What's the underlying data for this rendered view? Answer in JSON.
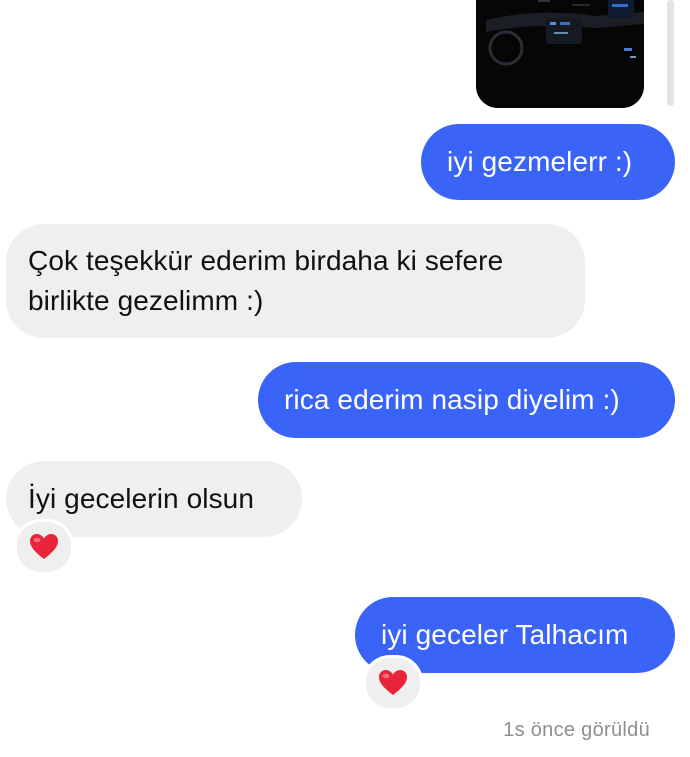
{
  "thread": {
    "messages": [
      {
        "sender": "me",
        "kind": "image"
      },
      {
        "sender": "me",
        "text": "iyi gezmelerr :)"
      },
      {
        "sender": "them",
        "text": "Çok teşekkür ederim birdaha ki sefere birlikte gezelimm :)"
      },
      {
        "sender": "me",
        "text": "rica ederim nasip diyelim :)"
      },
      {
        "sender": "them",
        "text": "İyi gecelerin olsun",
        "reaction": "heart-emoji"
      },
      {
        "sender": "me",
        "text": "iyi geceler Talhacım",
        "reaction": "heart-emoji"
      }
    ],
    "seen_status": "1s önce görüldü"
  },
  "colors": {
    "outgoing_bubble": "#3a63f7",
    "incoming_bubble": "#efefef",
    "reaction_heart": "#e8243b",
    "status_text": "#8e8e93"
  }
}
